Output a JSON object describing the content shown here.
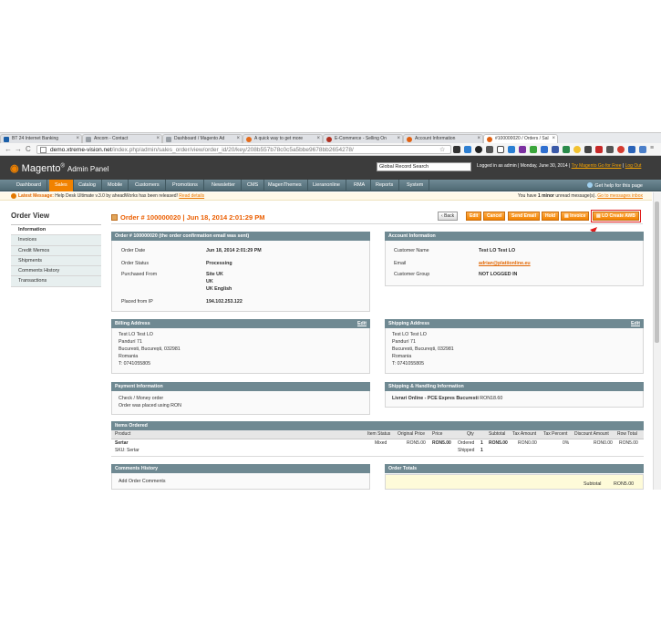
{
  "browser": {
    "tabs": [
      {
        "label": "BT 24 Internet Banking",
        "color": "#1b5fa8"
      },
      {
        "label": "Ancom - Contact",
        "color": "#9aa0a6"
      },
      {
        "label": "Dashboard / Magento Ad",
        "color": "#9aa0a6"
      },
      {
        "label": "A quick way to get more",
        "color": "#e46c1c"
      },
      {
        "label": "E-Commerce - Selling On",
        "color": "#b03020"
      },
      {
        "label": "Account Information",
        "color": "#e06010"
      },
      {
        "label": "#100000020 / Orders / Sal",
        "color": "#e06010"
      }
    ],
    "url_host": "demo.xtreme-vision.net",
    "url_path": "/index.php/admin/sales_order/view/order_id/20/key/208b557b78c0c5a5bbe9678bb2654278/"
  },
  "header": {
    "logo_main": "Magento",
    "logo_sub": "Admin Panel",
    "search_value": "Global Record Search",
    "logged_in": "Logged in as admin",
    "separator": "|",
    "date": "Monday, June 30, 2014",
    "try_link": "Try Magento Go for Free",
    "logout": "Log Out"
  },
  "nav": {
    "items": [
      "Dashboard",
      "Sales",
      "Catalog",
      "Mobile",
      "Customers",
      "Promotions",
      "Newsletter",
      "CMS",
      "MagenThemes",
      "Lieranonline",
      "RMA",
      "Reports",
      "System"
    ],
    "help": "Get help for this page"
  },
  "message": {
    "label": "Latest Message:",
    "text": "Help Desk Ultimate v.3.0 by aheadWorks has been released!",
    "link": "Read details",
    "right_pre": "You have",
    "right_count": "1 minor",
    "right_mid": "unread message(s).",
    "right_link": "Go to messages inbox"
  },
  "sidebar": {
    "title": "Order View",
    "items": [
      "Information",
      "Invoices",
      "Credit Memos",
      "Shipments",
      "Comments History",
      "Transactions"
    ]
  },
  "page": {
    "title": "Order # 100000020 | Jun 18, 2014 2:01:29 PM",
    "buttons": [
      "Back",
      "Edit",
      "Cancel",
      "Send Email",
      "Hold",
      "Invoice",
      "LO Create AWB"
    ]
  },
  "order_box": {
    "title": "Order # 100000020 (the order confirmation email was sent)",
    "rows": [
      {
        "label": "Order Date",
        "value": "Jun 18, 2014 2:01:29 PM"
      },
      {
        "label": "Order Status",
        "value": "Processing"
      },
      {
        "label": "Purchased From",
        "value": "Site UK",
        "value2": "UK",
        "value3": "UK English"
      },
      {
        "label": "Placed from IP",
        "value": "194.102.253.122"
      }
    ]
  },
  "account_box": {
    "title": "Account Information",
    "rows": [
      {
        "label": "Customer Name",
        "value": "Test LO Test LO"
      },
      {
        "label": "Email",
        "value": "adrian@platiionline.eu"
      },
      {
        "label": "Customer Group",
        "value": "NOT LOGGED IN"
      }
    ]
  },
  "billing": {
    "title": "Billing Address",
    "edit": "Edit",
    "lines": [
      "Test LO Test LO",
      "Pandurí 71",
      "Bucuresti, București, 032981",
      "Romania",
      "T: 0741055805"
    ]
  },
  "shipping": {
    "title": "Shipping Address",
    "edit": "Edit",
    "lines": [
      "Test LO Test LO",
      "Pandurí 71",
      "Bucuresti, București, 032981",
      "Romania",
      "T: 0741055805"
    ]
  },
  "payment": {
    "title": "Payment Information",
    "lines": [
      "Check / Money order",
      "Order was placed using RON"
    ]
  },
  "shipping_method": {
    "title": "Shipping & Handling Information",
    "method": "Livrari Online - PCE Expres Bucuresti",
    "price": "RON18.60"
  },
  "items": {
    "title": "Items Ordered",
    "columns": [
      "Product",
      "Item Status",
      "Original Price",
      "Price",
      "Qty",
      "Subtotal",
      "Tax Amount",
      "Tax Percent",
      "Discount Amount",
      "Row Total"
    ],
    "row": {
      "product": "Sertar",
      "sku": "SKU: Sertar",
      "status": "Mixed",
      "original_price": "RON5.00",
      "price": "RON5.00",
      "qty_ordered": "Ordered",
      "qty_ordered_n": "1",
      "qty_shipped": "Shipped",
      "qty_shipped_n": "1",
      "subtotal": "RON5.00",
      "tax_amount": "RON0.00",
      "tax_percent": "0%",
      "discount": "RON0.00",
      "row_total": "RON5.00"
    }
  },
  "comments": {
    "title": "Comments History",
    "add": "Add Order Comments"
  },
  "totals": {
    "title": "Order Totals",
    "subtotal_label": "Subtotal",
    "subtotal_value": "RON5.00"
  },
  "colors": {
    "accent": "#f18200",
    "nav": "#5e7a85",
    "box_head": "#6f8992",
    "annotation_arrow": "#e01b1b"
  }
}
